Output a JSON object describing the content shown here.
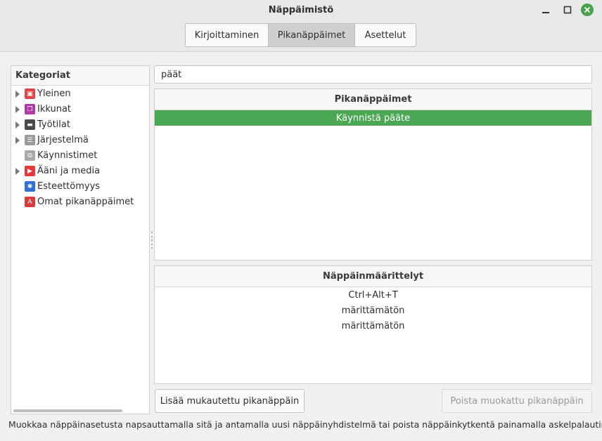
{
  "window": {
    "title": "Näppäimistö"
  },
  "tabs": [
    {
      "label": "Kirjoittaminen",
      "active": false
    },
    {
      "label": "Pikanäppäimet",
      "active": true
    },
    {
      "label": "Asettelut",
      "active": false
    }
  ],
  "categories": {
    "header": "Kategoriat",
    "items": [
      {
        "label": "Yleinen",
        "expandable": true,
        "icon": "general-icon",
        "icon_color": "#e0454a"
      },
      {
        "label": "Ikkunat",
        "expandable": true,
        "icon": "windows-icon",
        "icon_color": "#b03aa6"
      },
      {
        "label": "Työtilat",
        "expandable": true,
        "icon": "workspaces-icon",
        "icon_color": "#4a4a4a"
      },
      {
        "label": "Järjestelmä",
        "expandable": true,
        "icon": "system-icon",
        "icon_color": "#9a9a9a"
      },
      {
        "label": "Käynnistimet",
        "expandable": false,
        "icon": "launchers-icon",
        "icon_color": "#a8a8a8"
      },
      {
        "label": "Ääni ja media",
        "expandable": true,
        "icon": "sound-media-icon",
        "icon_color": "#e33a3a"
      },
      {
        "label": "Esteettömyys",
        "expandable": false,
        "icon": "accessibility-icon",
        "icon_color": "#2f6fd6"
      },
      {
        "label": "Omat pikanäppäimet",
        "expandable": false,
        "icon": "custom-shortcuts-icon",
        "icon_color": "#d93a3a"
      }
    ]
  },
  "search": {
    "value": "päät"
  },
  "shortcuts": {
    "header": "Pikanäppäimet",
    "items": [
      {
        "label": "Käynnistä pääte",
        "selected": true
      }
    ]
  },
  "bindings": {
    "header": "Näppäinmäärittelyt",
    "items": [
      {
        "label": "Ctrl+Alt+T"
      },
      {
        "label": "märittämätön"
      },
      {
        "label": "märittämätön"
      }
    ]
  },
  "buttons": {
    "add_label": "Lisää mukautettu pikanäppäin",
    "remove_label": "Poista muokattu pikanäppäin"
  },
  "footer": {
    "text": "Muokkaa näppäinasetusta napsauttamalla sitä ja antamalla uusi näppäinyhdistelmä tai poista näppäinkytkentä painamalla askelpalautinta."
  },
  "colors": {
    "accent": "#4ba754",
    "close_button": "#4aa04c"
  }
}
